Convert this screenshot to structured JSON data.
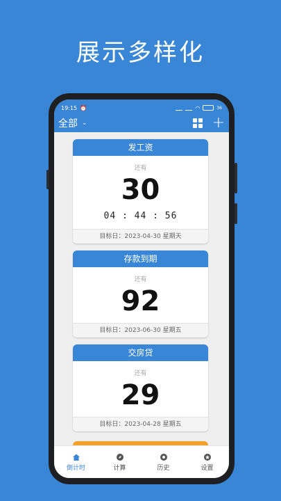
{
  "headline": "展示多样化",
  "status": {
    "time": "19:15",
    "battery": "36"
  },
  "toolbar": {
    "filter_label": "全部"
  },
  "cards": [
    {
      "title": "发工资",
      "remain_label": "还有",
      "days": "30",
      "time": "04 : 44 : 56",
      "target": "目标日：2023-04-30 星期天"
    },
    {
      "title": "存款到期",
      "remain_label": "还有",
      "days": "92",
      "target": "目标日：2023-06-30 星期五"
    },
    {
      "title": "交房贷",
      "remain_label": "还有",
      "days": "29",
      "target": "目标日：2023-04-28 星期五"
    }
  ],
  "tabs": [
    {
      "label": "倒计时",
      "icon": "home-icon",
      "active": true
    },
    {
      "label": "计算",
      "icon": "compass-icon"
    },
    {
      "label": "历史",
      "icon": "shutter-icon"
    },
    {
      "label": "设置",
      "icon": "star-settings-icon"
    }
  ],
  "colors": {
    "accent": "#3a86d6",
    "peek_card": "#f2a22a"
  }
}
